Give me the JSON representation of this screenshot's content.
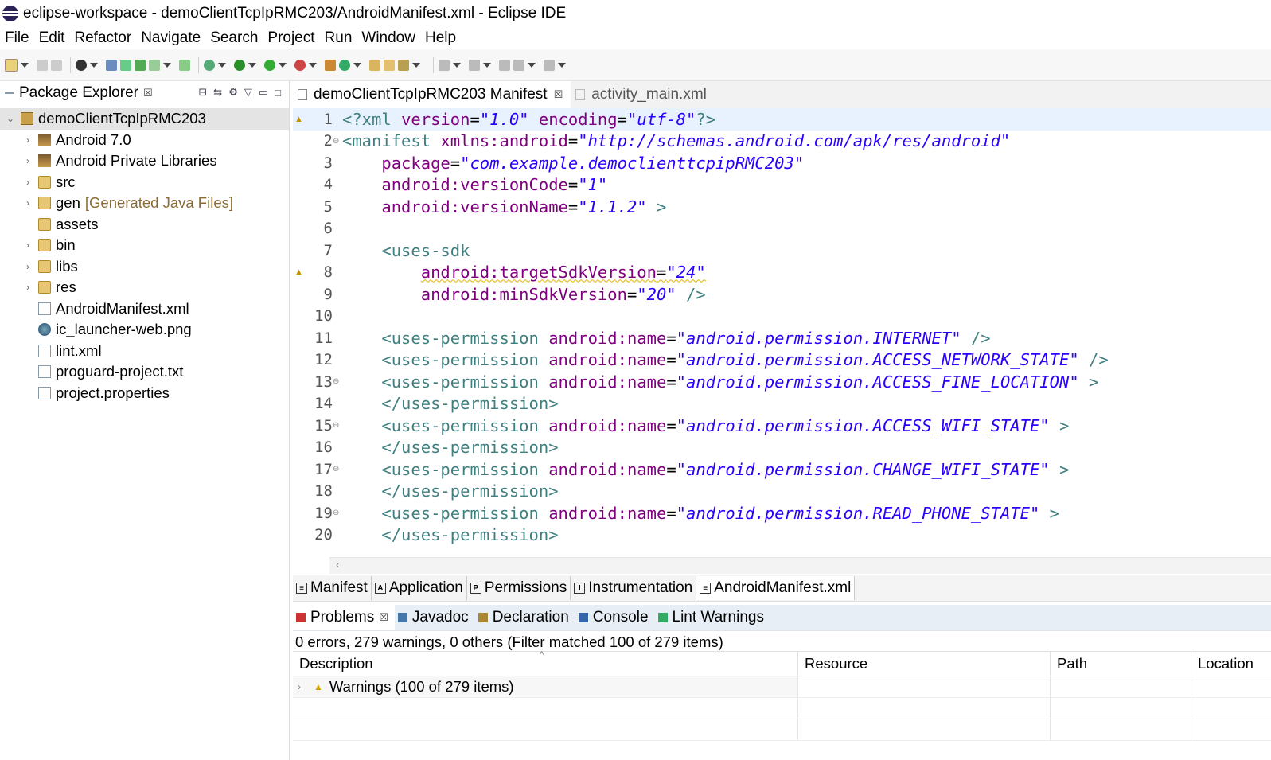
{
  "window": {
    "title": "eclipse-workspace - demoClientTcpIpRMC203/AndroidManifest.xml - Eclipse IDE"
  },
  "menu": [
    "File",
    "Edit",
    "Refactor",
    "Navigate",
    "Search",
    "Project",
    "Run",
    "Window",
    "Help"
  ],
  "package_explorer": {
    "title": "Package Explorer",
    "close_glyph": "☒",
    "project": "demoClientTcpIpRMC203",
    "items": [
      {
        "label": "Android 7.0",
        "extra": "",
        "icon": "library-icon",
        "expandable": true
      },
      {
        "label": "Android Private Libraries",
        "extra": "",
        "icon": "library-icon",
        "expandable": true
      },
      {
        "label": "src",
        "extra": "",
        "icon": "package-folder-icon",
        "expandable": true
      },
      {
        "label": "gen",
        "extra": "[Generated Java Files]",
        "icon": "package-folder-icon",
        "expandable": true
      },
      {
        "label": "assets",
        "extra": "",
        "icon": "folder-icon",
        "expandable": false
      },
      {
        "label": "bin",
        "extra": "",
        "icon": "folder-icon",
        "expandable": true
      },
      {
        "label": "libs",
        "extra": "",
        "icon": "folder-icon",
        "expandable": true
      },
      {
        "label": "res",
        "extra": "",
        "icon": "folder-icon",
        "expandable": true
      },
      {
        "label": "AndroidManifest.xml",
        "extra": "",
        "icon": "xml-file-icon",
        "expandable": false
      },
      {
        "label": "ic_launcher-web.png",
        "extra": "",
        "icon": "image-file-icon",
        "expandable": false
      },
      {
        "label": "lint.xml",
        "extra": "",
        "icon": "xml-file-icon",
        "expandable": false
      },
      {
        "label": "proguard-project.txt",
        "extra": "",
        "icon": "text-file-icon",
        "expandable": false
      },
      {
        "label": "project.properties",
        "extra": "",
        "icon": "text-file-icon",
        "expandable": false
      }
    ]
  },
  "editor": {
    "tabs": [
      {
        "label": "demoClientTcpIpRMC203 Manifest",
        "active": true
      },
      {
        "label": "activity_main.xml",
        "active": false
      }
    ],
    "lines": [
      {
        "n": "1",
        "warn": true,
        "fold": false,
        "hl": true,
        "parts": [
          [
            "tag",
            "<?xml "
          ],
          [
            "attr",
            "version"
          ],
          [
            "plain",
            "="
          ],
          [
            "val",
            "\"1.0\""
          ],
          [
            "plain",
            " "
          ],
          [
            "attr",
            "encoding"
          ],
          [
            "plain",
            "="
          ],
          [
            "val",
            "\"utf-8\""
          ],
          [
            "tag",
            "?>"
          ]
        ]
      },
      {
        "n": "2",
        "warn": false,
        "fold": true,
        "hl": false,
        "parts": [
          [
            "tag",
            "<manifest "
          ],
          [
            "attr",
            "xmlns:android"
          ],
          [
            "plain",
            "="
          ],
          [
            "val",
            "\"http://schemas.android.com/apk/res/android\""
          ]
        ]
      },
      {
        "n": "3",
        "warn": false,
        "fold": false,
        "hl": false,
        "parts": [
          [
            "plain",
            "    "
          ],
          [
            "attr",
            "package"
          ],
          [
            "plain",
            "="
          ],
          [
            "val",
            "\"com.example.democlienttcpipRMC203\""
          ]
        ]
      },
      {
        "n": "4",
        "warn": false,
        "fold": false,
        "hl": false,
        "parts": [
          [
            "plain",
            "    "
          ],
          [
            "attr",
            "android:versionCode"
          ],
          [
            "plain",
            "="
          ],
          [
            "val",
            "\"1\""
          ]
        ]
      },
      {
        "n": "5",
        "warn": false,
        "fold": false,
        "hl": false,
        "parts": [
          [
            "plain",
            "    "
          ],
          [
            "attr",
            "android:versionName"
          ],
          [
            "plain",
            "="
          ],
          [
            "val",
            "\"1.1.2\""
          ],
          [
            "tag",
            " >"
          ]
        ]
      },
      {
        "n": "6",
        "warn": false,
        "fold": false,
        "hl": false,
        "parts": []
      },
      {
        "n": "7",
        "warn": false,
        "fold": false,
        "hl": false,
        "parts": [
          [
            "plain",
            "    "
          ],
          [
            "tag",
            "<uses-sdk"
          ]
        ]
      },
      {
        "n": "8",
        "warn": true,
        "fold": false,
        "hl": false,
        "parts": [
          [
            "plain",
            "        "
          ],
          [
            "attr-sq",
            "android:targetSdkVersion"
          ],
          [
            "plain-sq",
            "="
          ],
          [
            "val-sq",
            "\"24\""
          ]
        ]
      },
      {
        "n": "9",
        "warn": false,
        "fold": false,
        "hl": false,
        "parts": [
          [
            "plain",
            "        "
          ],
          [
            "attr",
            "android:minSdkVersion"
          ],
          [
            "plain",
            "="
          ],
          [
            "val",
            "\"20\""
          ],
          [
            "tag",
            " />"
          ]
        ]
      },
      {
        "n": "10",
        "warn": false,
        "fold": false,
        "hl": false,
        "parts": []
      },
      {
        "n": "11",
        "warn": false,
        "fold": false,
        "hl": false,
        "parts": [
          [
            "plain",
            "    "
          ],
          [
            "tag",
            "<uses-permission "
          ],
          [
            "attr",
            "android:name"
          ],
          [
            "plain",
            "="
          ],
          [
            "val",
            "\"android.permission.INTERNET\""
          ],
          [
            "tag",
            " />"
          ]
        ]
      },
      {
        "n": "12",
        "warn": false,
        "fold": false,
        "hl": false,
        "parts": [
          [
            "plain",
            "    "
          ],
          [
            "tag",
            "<uses-permission "
          ],
          [
            "attr",
            "android:name"
          ],
          [
            "plain",
            "="
          ],
          [
            "val",
            "\"android.permission.ACCESS_NETWORK_STATE\""
          ],
          [
            "tag",
            " />"
          ]
        ]
      },
      {
        "n": "13",
        "warn": false,
        "fold": true,
        "hl": false,
        "parts": [
          [
            "plain",
            "    "
          ],
          [
            "tag",
            "<uses-permission "
          ],
          [
            "attr",
            "android:name"
          ],
          [
            "plain",
            "="
          ],
          [
            "val",
            "\"android.permission.ACCESS_FINE_LOCATION\""
          ],
          [
            "tag",
            " >"
          ]
        ]
      },
      {
        "n": "14",
        "warn": false,
        "fold": false,
        "hl": false,
        "parts": [
          [
            "plain",
            "    "
          ],
          [
            "tag",
            "</uses-permission>"
          ]
        ]
      },
      {
        "n": "15",
        "warn": false,
        "fold": true,
        "hl": false,
        "parts": [
          [
            "plain",
            "    "
          ],
          [
            "tag",
            "<uses-permission "
          ],
          [
            "attr",
            "android:name"
          ],
          [
            "plain",
            "="
          ],
          [
            "val",
            "\"android.permission.ACCESS_WIFI_STATE\""
          ],
          [
            "tag",
            " >"
          ]
        ]
      },
      {
        "n": "16",
        "warn": false,
        "fold": false,
        "hl": false,
        "parts": [
          [
            "plain",
            "    "
          ],
          [
            "tag",
            "</uses-permission>"
          ]
        ]
      },
      {
        "n": "17",
        "warn": false,
        "fold": true,
        "hl": false,
        "parts": [
          [
            "plain",
            "    "
          ],
          [
            "tag",
            "<uses-permission "
          ],
          [
            "attr",
            "android:name"
          ],
          [
            "plain",
            "="
          ],
          [
            "val",
            "\"android.permission.CHANGE_WIFI_STATE\""
          ],
          [
            "tag",
            " >"
          ]
        ]
      },
      {
        "n": "18",
        "warn": false,
        "fold": false,
        "hl": false,
        "parts": [
          [
            "plain",
            "    "
          ],
          [
            "tag",
            "</uses-permission>"
          ]
        ]
      },
      {
        "n": "19",
        "warn": false,
        "fold": true,
        "hl": false,
        "parts": [
          [
            "plain",
            "    "
          ],
          [
            "tag",
            "<uses-permission "
          ],
          [
            "attr",
            "android:name"
          ],
          [
            "plain",
            "="
          ],
          [
            "val",
            "\"android.permission.READ_PHONE_STATE\""
          ],
          [
            "tag",
            " >"
          ]
        ]
      },
      {
        "n": "20",
        "warn": false,
        "fold": false,
        "hl": false,
        "parts": [
          [
            "plain",
            "    "
          ],
          [
            "tag",
            "</uses-permission>"
          ]
        ]
      }
    ]
  },
  "page_tabs": [
    {
      "label": "Manifest",
      "icon": "manifest-icon",
      "glyph": "≡",
      "active": false
    },
    {
      "label": "Application",
      "icon": "application-icon",
      "glyph": "A",
      "active": false
    },
    {
      "label": "Permissions",
      "icon": "permissions-icon",
      "glyph": "P",
      "active": false
    },
    {
      "label": "Instrumentation",
      "icon": "instrumentation-icon",
      "glyph": "I",
      "active": false
    },
    {
      "label": "AndroidManifest.xml",
      "icon": "xml-file-icon",
      "glyph": "≡",
      "active": true
    }
  ],
  "bottom_panel": {
    "tabs": [
      {
        "label": "Problems",
        "icon": "problems-icon",
        "active": true,
        "closable": true
      },
      {
        "label": "Javadoc",
        "icon": "javadoc-icon",
        "active": false,
        "closable": false
      },
      {
        "label": "Declaration",
        "icon": "declaration-icon",
        "active": false,
        "closable": false
      },
      {
        "label": "Console",
        "icon": "console-icon",
        "active": false,
        "closable": false
      },
      {
        "label": "Lint Warnings",
        "icon": "lint-warnings-icon",
        "active": false,
        "closable": false
      }
    ],
    "summary": "0 errors, 279 warnings, 0 others (Filter matched 100 of 279 items)",
    "columns": [
      "Description",
      "Resource",
      "Path",
      "Location"
    ],
    "rows": [
      {
        "description": "Warnings (100 of 279 items)"
      }
    ]
  },
  "colors": {
    "tag": "#3f7f7f",
    "attr": "#7f007f",
    "value": "#2a00ff",
    "current_line": "#e8f2fe",
    "warning": "#e0b000"
  }
}
